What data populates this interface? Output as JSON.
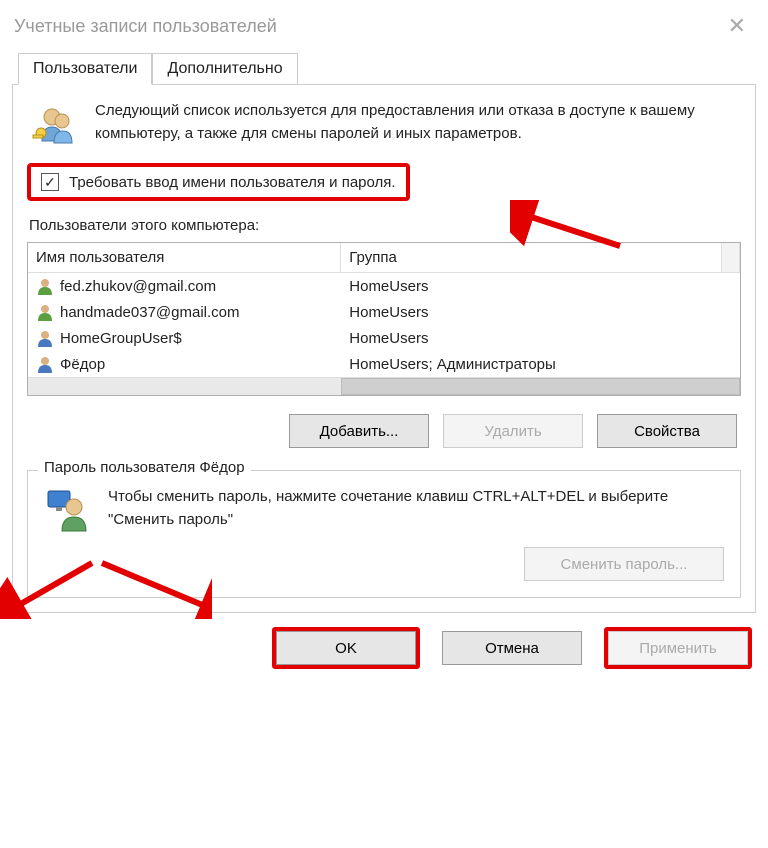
{
  "title": "Учетные записи пользователей",
  "tabs": {
    "users": "Пользователи",
    "advanced": "Дополнительно"
  },
  "intro": "Следующий список используется для предоставления или отказа в доступе к вашему компьютеру, а также для смены паролей и иных параметров.",
  "checkbox_label": "Требовать ввод имени пользователя и пароля.",
  "list_label": "Пользователи этого компьютера:",
  "columns": {
    "username": "Имя пользователя",
    "group": "Группа"
  },
  "users": [
    {
      "name": "fed.zhukov@gmail.com",
      "group": "HomeUsers"
    },
    {
      "name": "handmade037@gmail.com",
      "group": "HomeUsers"
    },
    {
      "name": "HomeGroupUser$",
      "group": "HomeUsers"
    },
    {
      "name": "Фёдор",
      "group": "HomeUsers; Администраторы"
    }
  ],
  "buttons": {
    "add": "Добавить...",
    "delete": "Удалить",
    "properties": "Свойства",
    "change_password": "Сменить пароль...",
    "ok": "OK",
    "cancel": "Отмена",
    "apply": "Применить"
  },
  "password_section": {
    "legend": "Пароль пользователя Фёдор",
    "text": "Чтобы сменить пароль, нажмите сочетание клавиш CTRL+ALT+DEL и выберите \"Сменить пароль\""
  }
}
